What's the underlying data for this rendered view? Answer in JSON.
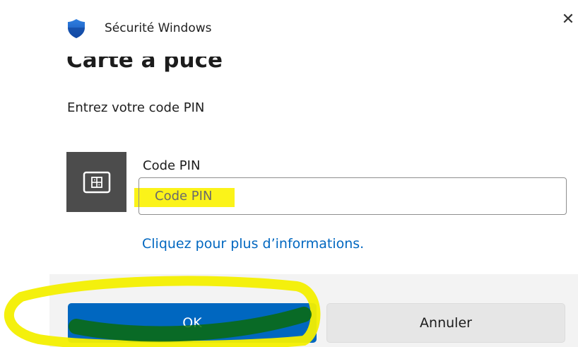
{
  "app": {
    "title": "Sécurité Windows",
    "icon": "shield-icon",
    "close_glyph": "✕"
  },
  "dialog": {
    "title": "Carte à puce",
    "instruction": "Entrez votre code PIN"
  },
  "pin_field": {
    "label": "Code PIN",
    "placeholder": "Code PIN",
    "value": "",
    "icon": "smart-card-icon"
  },
  "link": {
    "text": "Cliquez pour plus d’informations."
  },
  "buttons": {
    "ok_label": "OK",
    "cancel_label": "Annuler"
  },
  "colors": {
    "accent": "#0067c0",
    "tile": "#4c4c4c",
    "footer": "#f3f3f3",
    "highlight_yellow": "#fbf200",
    "highlight_green": "#0a6b0a"
  }
}
